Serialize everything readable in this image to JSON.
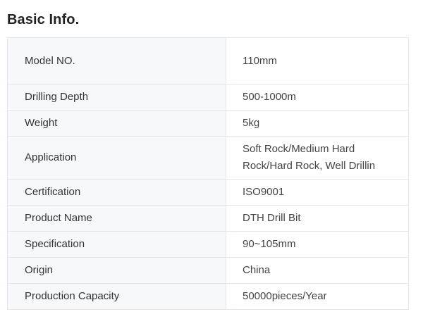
{
  "section": {
    "title": "Basic Info."
  },
  "specs": [
    {
      "label": "Model NO.",
      "value": "110mm"
    },
    {
      "label": "Drilling Depth",
      "value": "500-1000m"
    },
    {
      "label": "Weight",
      "value": "5kg"
    },
    {
      "label": "Application",
      "value": "Soft Rock/Medium Hard Rock/Hard Rock, Well Drillin"
    },
    {
      "label": "Certification",
      "value": "ISO9001"
    },
    {
      "label": "Product Name",
      "value": "DTH Drill Bit"
    },
    {
      "label": "Specification",
      "value": "90~105mm"
    },
    {
      "label": "Origin",
      "value": "China"
    },
    {
      "label": "Production Capacity",
      "value": "50000pieces/Year"
    }
  ]
}
